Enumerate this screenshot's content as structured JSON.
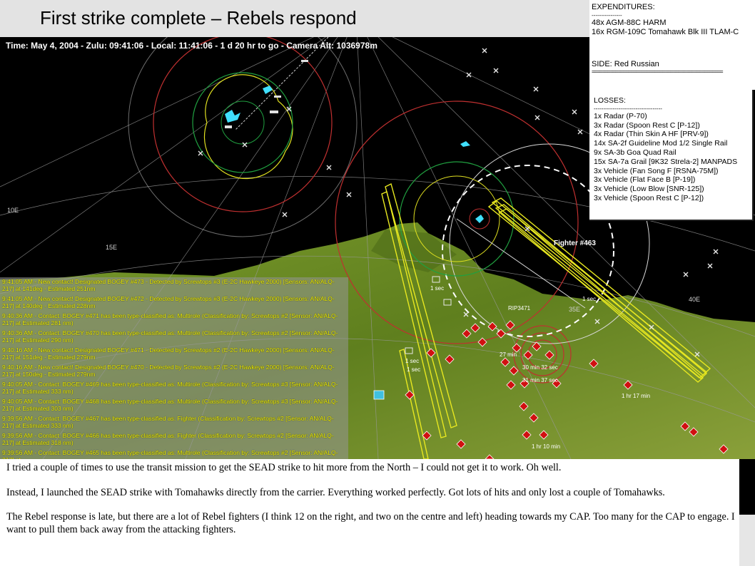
{
  "header": {
    "title": "First strike complete – Rebels respond"
  },
  "map": {
    "time_readout": "Time: May 4, 2004 - Zulu: 09:41:06 - Local: 11:41:06 - 1 d 20 hr to go -  Camera Alt: 1036978m",
    "longitude_labels": [
      "10E",
      "15E",
      "35E",
      "40E"
    ],
    "unit_labels": [
      "Fighter #463",
      "RIP3471",
      "1 sec",
      "1 sec",
      "1 sec",
      "1 sec",
      "30 min 32 sec",
      "31 min 37 sec",
      "1 hr 17 min",
      "1 hr 10 min",
      "27 min"
    ],
    "colors": {
      "land": "#6a8a22",
      "sea": "#000000",
      "range_ring_red": "#c03030",
      "range_ring_white": "#d0d0d0",
      "range_ring_yellow": "#e0e020",
      "range_ring_green": "#20a040",
      "flight_path": "#e8e820",
      "enemy_unit": "#d01010"
    }
  },
  "message_log": [
    "9:41:05 AM - New contact! Designated BOGEY #473 - Detected by Screwtops #3 (E-2C Hawkeye 2000)  [Sensors: AN/ALQ-217] at 141deg - Estimated 251nm",
    "9:41:05 AM - New contact! Designated BOGEY #472 - Detected by Screwtops #3 (E-2C Hawkeye 2000)  [Sensors: AN/ALQ-217] at 140deg - Estimated 228nm",
    "9:40:36 AM - Contact: BOGEY #471 has been type-classified as: Multirole (Classification by: Screwtops #2 [Sensor: AN/ALQ-217] at Estimated 281 nm)",
    "9:40:36 AM - Contact: BOGEY #470 has been type-classified as: Multirole (Classification by: Screwtops #2 [Sensor: AN/ALQ-217] at Estimated 290 nm)",
    "9:40:16 AM - New contact! Designated BOGEY #471 - Detected by Screwtops #2 (E-2C Hawkeye 2000)  [Sensors: AN/ALQ-217] at 151deg - Estimated 279nm",
    "9:40:16 AM - New contact! Designated BOGEY #470 - Detected by Screwtops #2 (E-2C Hawkeye 2000)  [Sensors: AN/ALQ-217] at 150deg - Estimated 279nm",
    "9:40:05 AM - Contact: BOGEY #469 has been type-classified as: Multirole (Classification by: Screwtops #3 [Sensor: AN/ALQ-217] at Estimated 333 nm)",
    "9:40:05 AM - Contact: BOGEY #468 has been type-classified as: Multirole (Classification by: Screwtops #3 [Sensor: AN/ALQ-217] at Estimated 303 nm)",
    "9:39:56 AM - Contact: BOGEY #467 has been type-classified as: Fighter (Classification by: Screwtops #2 [Sensor: AN/ALQ-217] at Estimated 333 nm)",
    "9:39:56 AM - Contact: BOGEY #466 has been type-classified as: Fighter (Classification by: Screwtops #2 [Sensor: AN/ALQ-217] at Estimated 318 nm)",
    "9:39:56 AM - Contact: BOGEY #465 has been type-classified as: Multirole (Classification by: Screwtops #2 [Sensor: AN/ALQ-217] at"
  ],
  "expenditures": {
    "heading": "EXPENDITURES:",
    "separator": "----------------",
    "items": [
      "48x AGM-88C HARM",
      "16x RGM-109C Tomahawk Blk III TLAM-C"
    ],
    "side_label": "SIDE: Red Russian",
    "double_separator": "=================================================="
  },
  "losses": {
    "heading": "LOSSES:",
    "separator": "------------------------------------",
    "items": [
      "1x Radar (P-70)",
      "3x Radar (Spoon Rest C [P-12])",
      "4x Radar (Thin Skin A HF [PRV-9])",
      "14x SA-2f Guideline Mod 1/2 Single Rail",
      "9x SA-3b Goa Quad Rail",
      "15x SA-7a Grail [9K32 Strela-2] MANPADS",
      "3x Vehicle (Fan Song F [RSNA-75M])",
      "3x Vehicle (Flat Face B [P-19])",
      "3x Vehicle (Low Blow [SNR-125])",
      "3x Vehicle (Spoon Rest C [P-12])"
    ]
  },
  "notes": [
    "I tried a couple of times to use the transit mission to get the SEAD strike to hit more from the North – I could not get it to work.  Oh well.",
    "Instead, I launched the SEAD strike with Tomahawks directly from the carrier.  Everything worked perfectly.  Got lots of hits and only lost a couple of Tomahawks.",
    "The Rebel response is late, but there are a lot of Rebel fighters (I think 12 on the right, and two on the centre and left) heading towards my CAP.  Too many for the CAP to engage.  I want to pull them back away from the attacking fighters."
  ]
}
